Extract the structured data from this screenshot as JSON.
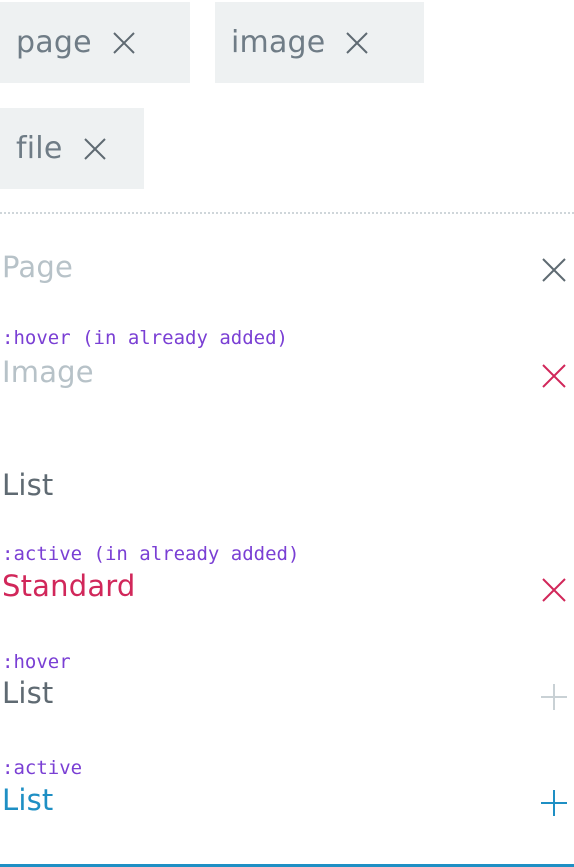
{
  "chips": [
    {
      "label": "page"
    },
    {
      "label": "image"
    },
    {
      "label": "file"
    }
  ],
  "rows": [
    {
      "state": "",
      "label": "Page"
    },
    {
      "state": ":hover (in already added)",
      "label": "Image"
    },
    {
      "state": "",
      "label": "List"
    },
    {
      "state": ":active (in already added)",
      "label": "Standard"
    },
    {
      "state": ":hover",
      "label": "List"
    },
    {
      "state": ":active",
      "label": "List"
    }
  ],
  "colors": {
    "chip_bg": "#eef1f2",
    "chip_text": "#6f7c86",
    "muted_text": "#b7c2c8",
    "default_text": "#5f6a72",
    "danger": "#d1275a",
    "accent": "#1e8fc4",
    "state_label": "#7a3fd4"
  },
  "icons": {
    "remove": "close-icon",
    "add": "plus-icon"
  }
}
